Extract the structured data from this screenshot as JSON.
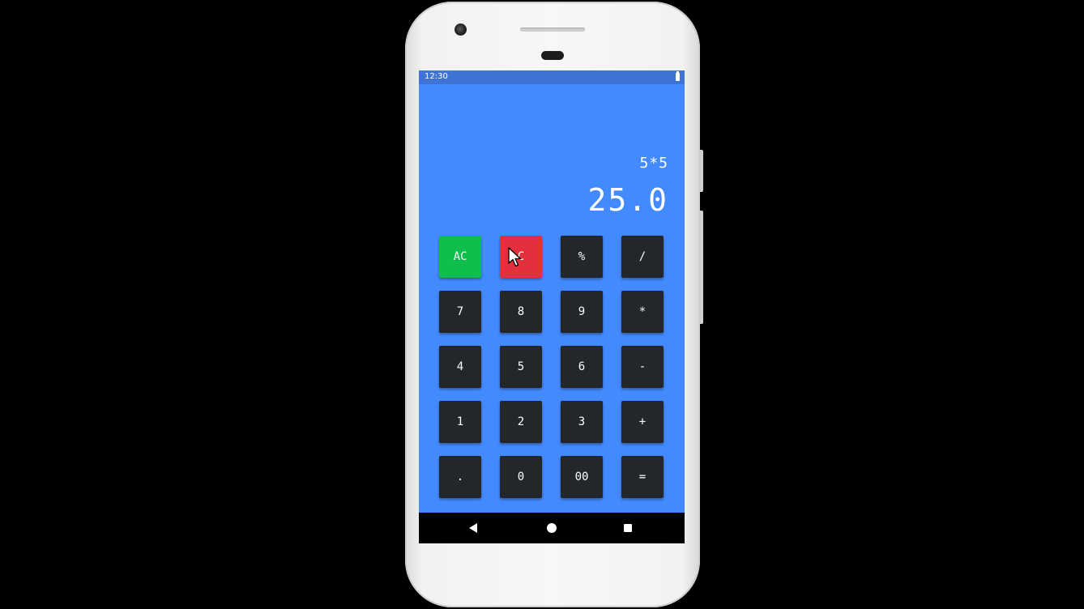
{
  "status_bar": {
    "time": "12:30",
    "battery_icon": "battery-full-icon"
  },
  "display": {
    "expression": "5*5",
    "result": "25.0"
  },
  "keypad": {
    "rows": [
      [
        "AC",
        "C",
        "%",
        "/"
      ],
      [
        "7",
        "8",
        "9",
        "*"
      ],
      [
        "4",
        "5",
        "6",
        "-"
      ],
      [
        "1",
        "2",
        "3",
        "+"
      ],
      [
        ".",
        "0",
        "00",
        "="
      ]
    ]
  },
  "nav_bar": {
    "back_icon": "back-triangle-icon",
    "home_icon": "home-circle-icon",
    "recents_icon": "recents-square-icon"
  },
  "colors": {
    "screen_background": "#448aff",
    "status_bar": "#3f74d6",
    "key_default": "#23262b",
    "key_clear_all": "#0fbf4e",
    "key_clear": "#e3303c",
    "text": "#ffffff"
  }
}
